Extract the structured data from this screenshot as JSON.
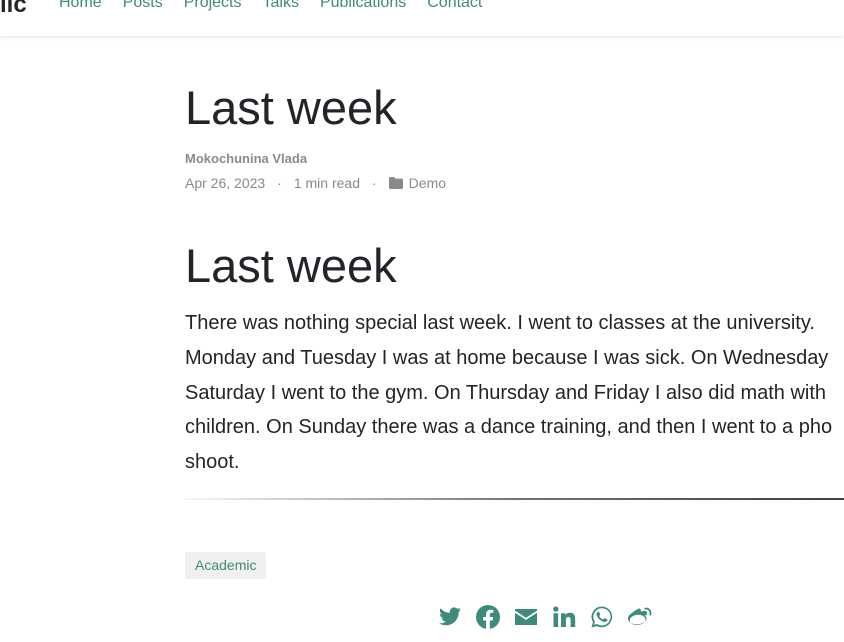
{
  "navbar": {
    "brand": "llc",
    "links": [
      "Home",
      "Posts",
      "Projects",
      "Talks",
      "Publications",
      "Contact"
    ]
  },
  "article": {
    "title": "Last week",
    "author": "Mokochunina Vlada",
    "date": "Apr 26, 2023",
    "separator": "·",
    "read_time": "1 min read",
    "category": "Demo",
    "heading": "Last week",
    "body_lines": [
      "There was nothing special last week. I went to classes at the university.",
      "Monday and Tuesday I was at home because I was sick. On Wednesday",
      "Saturday I went to the gym. On Thursday and Friday I also did math with",
      "children. On Sunday there was a dance training, and then I went to a pho",
      "shoot."
    ],
    "tag": "Academic"
  },
  "share_icons": [
    "twitter-icon",
    "facebook-icon",
    "envelope-icon",
    "linkedin-icon",
    "whatsapp-icon",
    "weibo-icon"
  ],
  "colors": {
    "accent": "#3f8a7b",
    "text": "#212529",
    "muted": "#8a8a8a",
    "tag_bg": "#f0f0f0"
  }
}
